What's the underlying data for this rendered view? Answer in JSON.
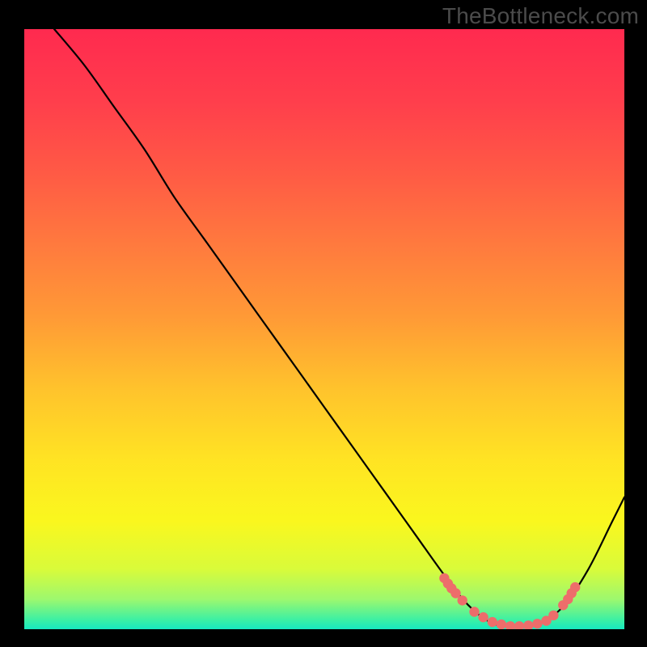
{
  "watermark": "TheBottleneck.com",
  "gradient": {
    "stops": [
      {
        "offset": 0.0,
        "color": "#ff2a4f"
      },
      {
        "offset": 0.12,
        "color": "#ff3e4c"
      },
      {
        "offset": 0.24,
        "color": "#ff5a45"
      },
      {
        "offset": 0.36,
        "color": "#ff7a3e"
      },
      {
        "offset": 0.48,
        "color": "#ff9a36"
      },
      {
        "offset": 0.6,
        "color": "#ffc32c"
      },
      {
        "offset": 0.72,
        "color": "#ffe423"
      },
      {
        "offset": 0.82,
        "color": "#faf71e"
      },
      {
        "offset": 0.9,
        "color": "#d9fb3a"
      },
      {
        "offset": 0.95,
        "color": "#9df86e"
      },
      {
        "offset": 0.985,
        "color": "#3af0a5"
      },
      {
        "offset": 1.0,
        "color": "#17e8c0"
      }
    ]
  },
  "chart_data": {
    "type": "line",
    "title": "",
    "xlabel": "",
    "ylabel": "",
    "xlim": [
      0,
      100
    ],
    "ylim": [
      0,
      100
    ],
    "grid": false,
    "legend": false,
    "series": [
      {
        "name": "bottleneck-curve",
        "x": [
          5,
          10,
          15,
          20,
          25,
          30,
          35,
          40,
          45,
          50,
          55,
          60,
          65,
          70,
          74,
          78,
          82,
          86,
          90,
          94,
          98,
          100
        ],
        "y": [
          100,
          94,
          87,
          80,
          72,
          65,
          58,
          51,
          44,
          37,
          30,
          23,
          16,
          9,
          4,
          1,
          0.5,
          1,
          4,
          10,
          18,
          22
        ]
      }
    ],
    "markers": {
      "name": "highlight-dots",
      "color": "#ed6d6b",
      "x": [
        70.0,
        70.6,
        71.2,
        71.9,
        73.0,
        75.0,
        76.5,
        78.0,
        79.5,
        81.0,
        82.5,
        84.0,
        85.5,
        87.0,
        88.2,
        89.8,
        90.6,
        91.2,
        91.8
      ],
      "y": [
        8.5,
        7.6,
        6.8,
        6.0,
        4.8,
        2.9,
        2.0,
        1.2,
        0.8,
        0.5,
        0.5,
        0.6,
        0.9,
        1.4,
        2.3,
        4.0,
        5.0,
        6.0,
        7.0
      ]
    }
  }
}
